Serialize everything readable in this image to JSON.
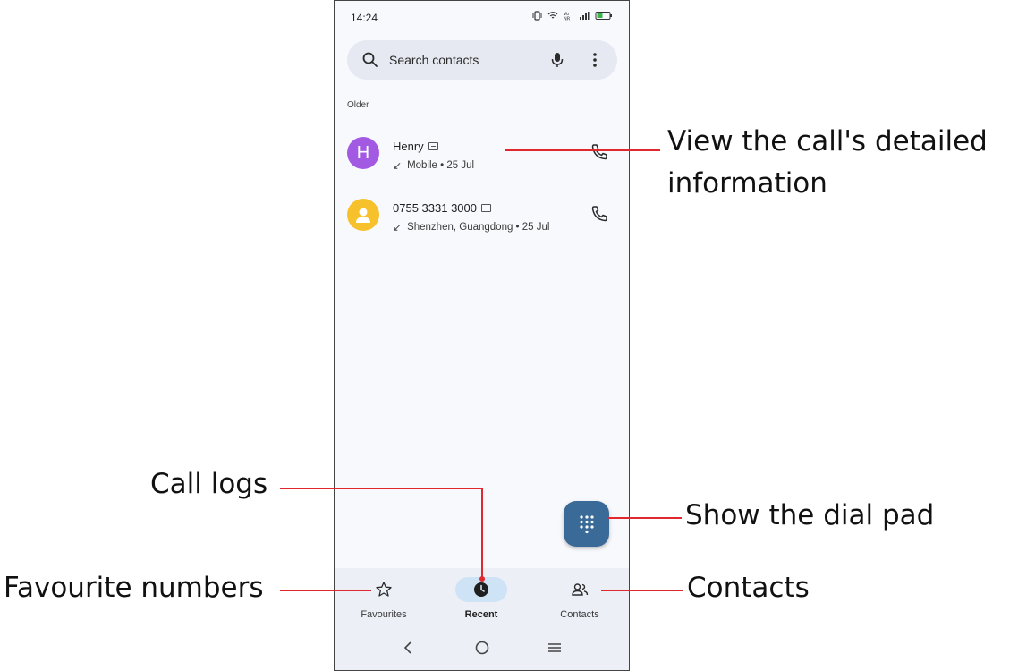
{
  "status_bar": {
    "time": "14:24"
  },
  "search": {
    "placeholder": "Search contacts"
  },
  "section": {
    "label": "Older"
  },
  "calls": [
    {
      "name": "Henry",
      "avatar_letter": "H",
      "avatar_color": "#a35ae2",
      "detail": "Mobile • 25 Jul"
    },
    {
      "name": "0755 3331 3000",
      "avatar_letter": "",
      "avatar_color": "#f6c12b",
      "detail": "Shenzhen, Guangdong • 25 Jul"
    }
  ],
  "nav": {
    "favourites": "Favourites",
    "recent": "Recent",
    "contacts": "Contacts"
  },
  "annotations": {
    "detail_line1": "View the call's detailed",
    "detail_line2": "information",
    "call_logs": "Call logs",
    "dial_pad": "Show the dial pad",
    "favourites": "Favourite numbers",
    "contacts": "Contacts"
  },
  "colors": {
    "accent": "#3a6a97",
    "annotation": "#e0282e",
    "active_tab_bg": "#cfe3f6"
  }
}
